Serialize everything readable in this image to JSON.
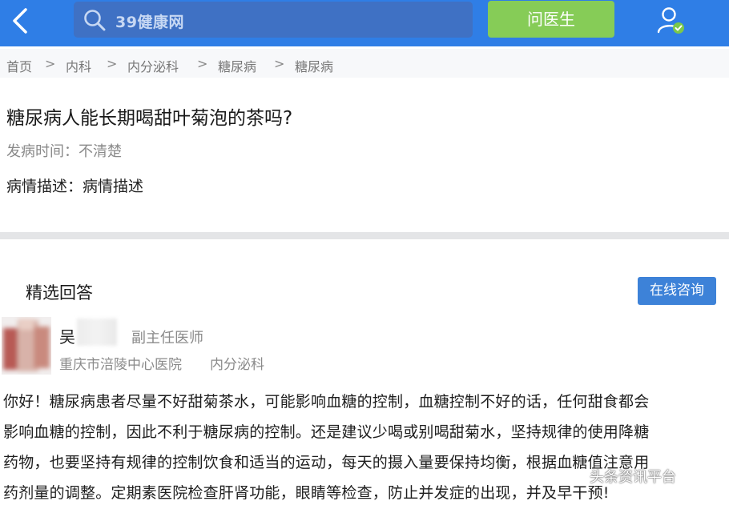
{
  "header": {
    "search_logo_text": "39健康网",
    "ask_button_label": "问医生"
  },
  "breadcrumb": {
    "items": [
      "首页",
      "内科",
      "内分泌科",
      "糖尿病",
      "糖尿病"
    ],
    "separator": ">"
  },
  "question": {
    "title": "糖尿病人能长期喝甜叶菊泡的茶吗?",
    "onset": "发病时间：不清楚",
    "description": "病情描述：病情描述"
  },
  "answers": {
    "section_title": "精选回答",
    "consult_button_label": "在线咨询",
    "doctor": {
      "name": "吴",
      "title": "副主任医师",
      "hospital": "重庆市涪陵中心医院",
      "department": "内分泌科"
    },
    "answer_lines": [
      "你好！糖尿病患者尽量不好甜菊茶水，可能影响血糖的控制，血糖控制不好的话，任何甜食都会",
      "影响血糖的控制，因此不利于糖尿病的控制。还是建议少喝或别喝甜菊水，坚持规律的使用降糖",
      "药物，也要坚持有规律的控制饮食和适当的运动，每天的摄入量要保持均衡，根据血糖值注意用",
      "药剂量的调整。定期素医院检查肝肾功能，眼睛等检查，防止并发症的出现，并及早干预!"
    ]
  },
  "watermark": {
    "text": "头条资讯平台"
  },
  "colors": {
    "header_bg": "#2f7ee6",
    "search_bg": "#3f71c4",
    "ask_button_bg": "#86cc57",
    "consult_button_bg": "#3d82d8",
    "verified_badge": "#7cc84a"
  },
  "icons": {
    "back": "chevron-left-icon",
    "search": "search-icon",
    "user": "user-verified-icon"
  }
}
